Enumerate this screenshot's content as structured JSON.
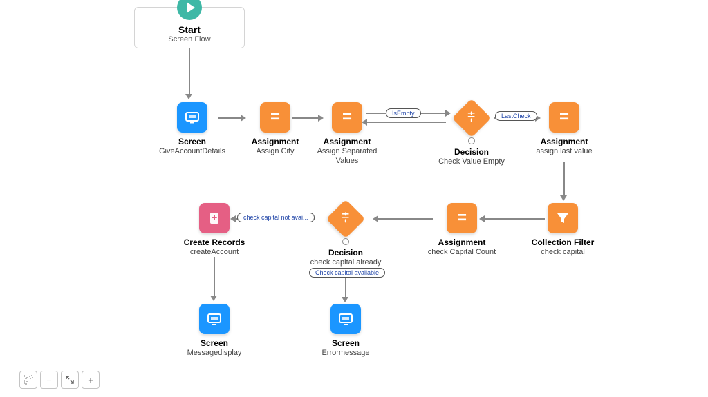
{
  "start": {
    "title": "Start",
    "subtitle": "Screen Flow"
  },
  "nodes": {
    "screen1": {
      "type": "Screen",
      "label": "GiveAccountDetails"
    },
    "assign1": {
      "type": "Assignment",
      "label": "Assign City"
    },
    "assign2": {
      "type": "Assignment",
      "label": "Assign Separated Values"
    },
    "decision1": {
      "type": "Decision",
      "label": "Check Value Empty"
    },
    "assign3": {
      "type": "Assignment",
      "label": "assign last value"
    },
    "filter1": {
      "type": "Collection Filter",
      "label": "check capital"
    },
    "assign4": {
      "type": "Assignment",
      "label": "check Capital Count"
    },
    "decision2": {
      "type": "Decision",
      "label": "check capital already selected"
    },
    "create1": {
      "type": "Create Records",
      "label": "createAccount"
    },
    "screen2": {
      "type": "Screen",
      "label": "Messagedisplay"
    },
    "screen3": {
      "type": "Screen",
      "label": "Errormessage"
    }
  },
  "connectors": {
    "isEmpty": "IsEmpty",
    "lastCheck": "LastCheck",
    "notAvail": "check capital not avai...",
    "avail": "Check capital available"
  },
  "toolbar": {
    "select": "⊡",
    "minus": "−",
    "fit": "⤡",
    "plus": "+"
  }
}
